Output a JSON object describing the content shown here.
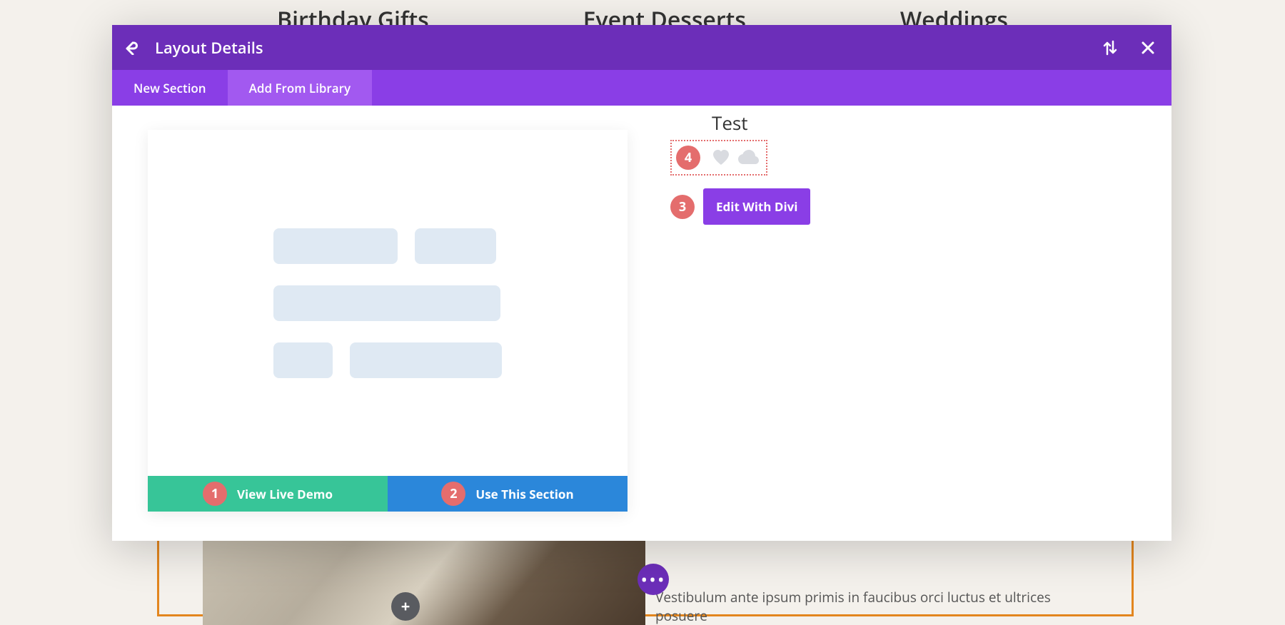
{
  "background": {
    "headings": [
      "Birthday Gifts",
      "Event Desserts",
      "Weddings"
    ],
    "paragraph": "Vestibulum ante ipsum primis in faucibus orci luctus et ultrices posuere"
  },
  "modal": {
    "title": "Layout Details",
    "tabs": {
      "new_section": "New Section",
      "add_from_library": "Add From Library"
    },
    "preview": {
      "view_demo": "View Live Demo",
      "use_section": "Use This Section"
    },
    "item": {
      "title": "Test",
      "edit_button": "Edit With Divi"
    },
    "badges": {
      "b1": "1",
      "b2": "2",
      "b3": "3",
      "b4": "4"
    }
  }
}
